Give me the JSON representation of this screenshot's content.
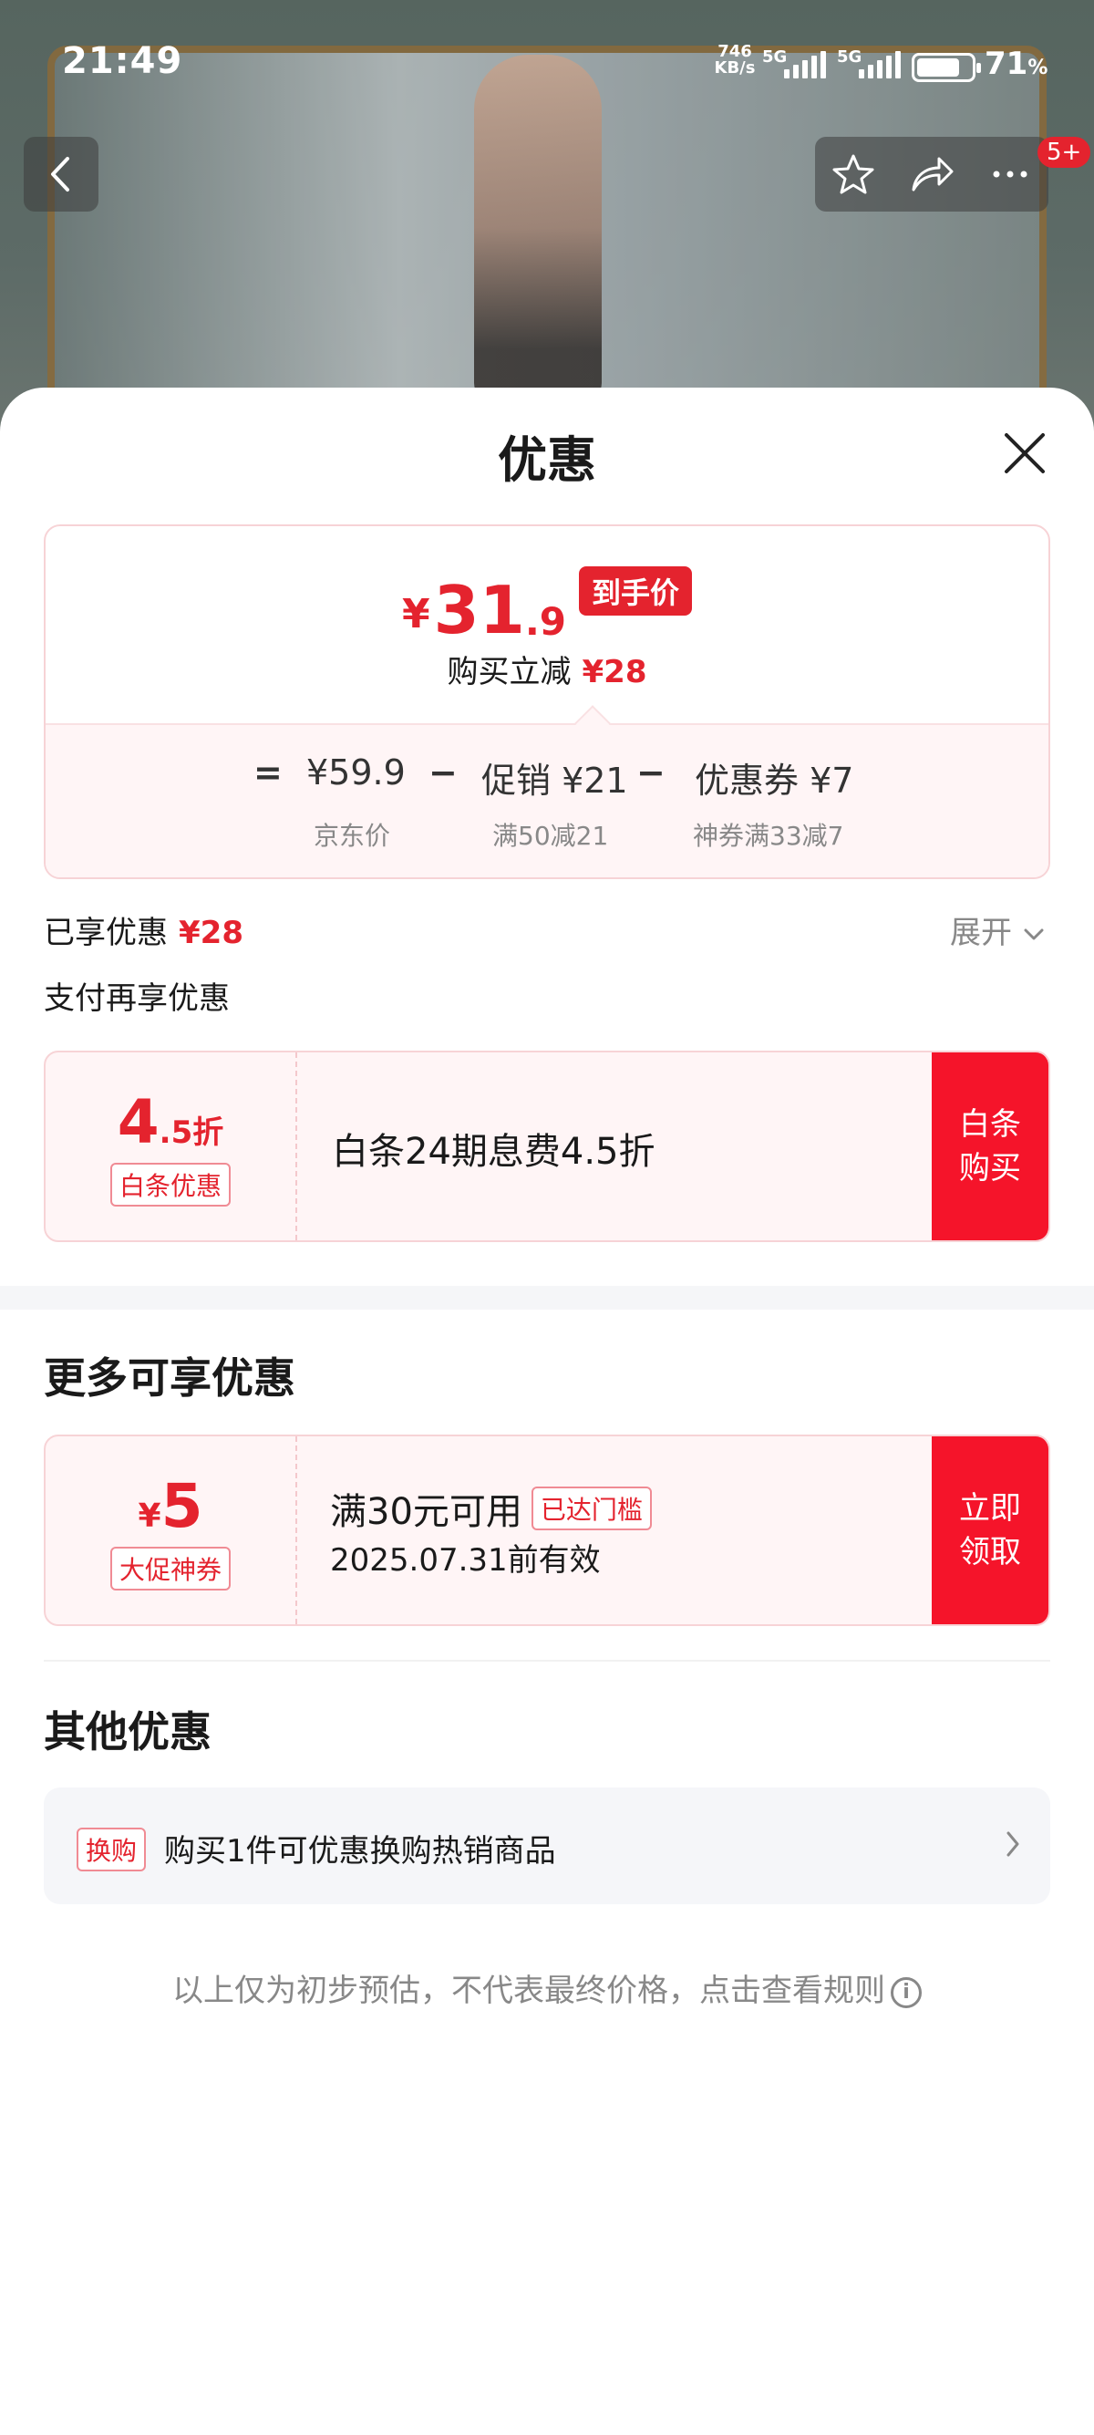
{
  "status_bar": {
    "time": "21:49",
    "net_speed_top": "746",
    "net_speed_bottom": "KB/s",
    "sim1": "5G",
    "sim2": "5G",
    "battery_pct": "71",
    "battery_unit": "%"
  },
  "nav": {
    "badge": "5+"
  },
  "sheet": {
    "title": "优惠"
  },
  "price": {
    "currency": "¥",
    "integer": "31",
    "decimal": ".9",
    "tag": "到手价",
    "reduce_label": "购买立减",
    "reduce_value": "¥28",
    "equals": "=",
    "minus": "−",
    "jd_price": "¥59.9",
    "jd_price_label": "京东价",
    "promo": "促销 ¥21",
    "promo_label": "满50减21",
    "coupon": "优惠券 ¥7",
    "coupon_label": "神券满33减7"
  },
  "enjoyed": {
    "label": "已享优惠",
    "value": "¥28",
    "expand": "展开"
  },
  "pay_more": {
    "label": "支付再享优惠"
  },
  "baitiao": {
    "value_big": "4",
    "value_small": ".5折",
    "tag": "白条优惠",
    "desc": "白条24期息费4.5折",
    "button": "白条\n购买"
  },
  "more": {
    "title": "更多可享优惠",
    "currency": "¥",
    "value": "5",
    "tag": "大促神券",
    "condition": "满30元可用",
    "status": "已达门槛",
    "validity": "2025.07.31前有效",
    "button": "立即\n领取"
  },
  "other": {
    "title": "其他优惠",
    "tag": "换购",
    "text": "购买1件可优惠换购热销商品"
  },
  "footer": {
    "note": "以上仅为初步预估，不代表最终价格，点击查看规则",
    "info": "i"
  }
}
